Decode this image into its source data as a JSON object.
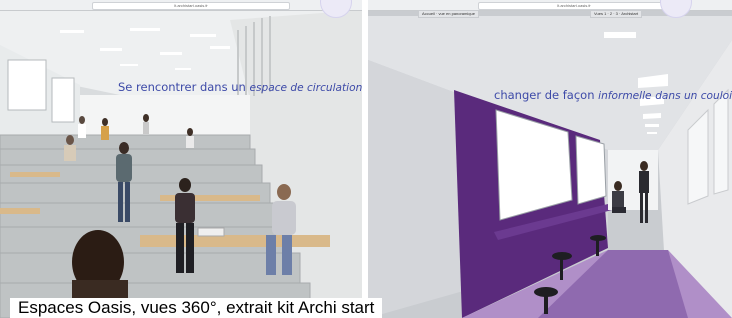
{
  "left_view": {
    "url": "lt.archistart.oasis.fr",
    "heading_main": "Se rencontrer dans un ",
    "heading_italic": "espace de circulation"
  },
  "right_view": {
    "url": "lt.archistart.oasis.fr",
    "tab_left_label": "Accueil · vue en panoramique",
    "tab_right_label": "Vues 1 · 2 · 3 · Archistart",
    "heading_main": "changer de façon ",
    "heading_italic_1": "informelle",
    "heading_mid": " ",
    "heading_italic_2": "dans un couloir"
  },
  "caption": "Espaces Oasis, vues 360°, extrait kit Archi start",
  "colors": {
    "heading_text": "#3d4aa8",
    "accent_purple": "#5a2a7c",
    "stair_stone": "#bfc3c4"
  },
  "icons": [
    "circle-button-icon",
    "circle-button-icon"
  ]
}
